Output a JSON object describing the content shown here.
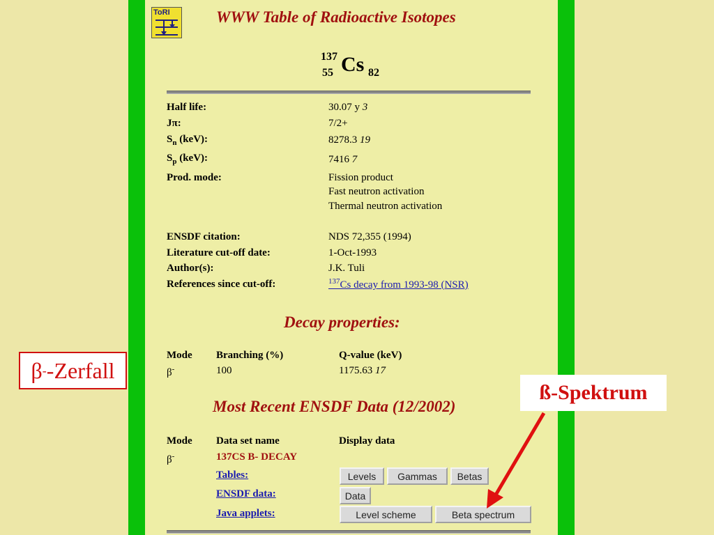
{
  "logo": {
    "text": "ToRI"
  },
  "title": "WWW Table of Radioactive Isotopes",
  "nuclide": {
    "mass": "137",
    "z": "55",
    "symbol": "Cs",
    "n": "82"
  },
  "props": {
    "half_life": {
      "label": "Half life:",
      "value": "30.07 y",
      "unc": "3"
    },
    "jpi": {
      "label_a": "J",
      "label_b": "π",
      "label_c": ":",
      "value": "7/2+"
    },
    "sn": {
      "label_a": "S",
      "label_sub": "n",
      "label_b": " (keV):",
      "value": "8278.3",
      "unc": "19"
    },
    "sp": {
      "label_a": "S",
      "label_sub": "p",
      "label_b": " (keV):",
      "value": "7416",
      "unc": "7"
    },
    "prod": {
      "label": "Prod. mode:",
      "values": [
        "Fission product",
        "Fast neutron activation",
        "Thermal neutron activation"
      ]
    },
    "citation": {
      "label": "ENSDF citation:",
      "value": "NDS 72,355 (1994)"
    },
    "cutoff": {
      "label": "Literature cut-off date:",
      "value": "1-Oct-1993"
    },
    "authors": {
      "label": "Author(s):",
      "value": "J.K. Tuli"
    },
    "refs": {
      "label": "References since cut-off:",
      "link_sup": "137",
      "link_text": "Cs decay from 1993-98 (NSR)"
    }
  },
  "decay": {
    "title": "Decay properties:",
    "headers": [
      "Mode",
      "Branching (%)",
      "Q-value (keV)"
    ],
    "mode": "β",
    "mode_sup": "-",
    "branching": "100",
    "qvalue": "1175.63",
    "q_unc": "17"
  },
  "ensdf": {
    "title": "Most Recent ENSDF Data (12/2002)",
    "headers": [
      "Mode",
      "Data set name",
      "Display data"
    ],
    "mode": "β",
    "mode_sup": "-",
    "dataset": "137CS B- DECAY",
    "rows": [
      {
        "label": "Tables:",
        "buttons": [
          "Levels",
          "Gammas",
          "Betas"
        ]
      },
      {
        "label": "ENSDF data:",
        "buttons": [
          "Data"
        ]
      },
      {
        "label": "Java applets:",
        "buttons": [
          "Level scheme",
          "Beta spectrum"
        ]
      }
    ]
  },
  "annotations": {
    "zerfall": {
      "beta": "β",
      "sup": "-",
      "text": "-Zerfall"
    },
    "spektrum": "ß-Spektrum"
  },
  "colors": {
    "background": "#EDE7A8",
    "green_bar": "#0AC10A",
    "header_red": "#A01010",
    "callout_red": "#D01010",
    "link": "#1A1AB0"
  }
}
